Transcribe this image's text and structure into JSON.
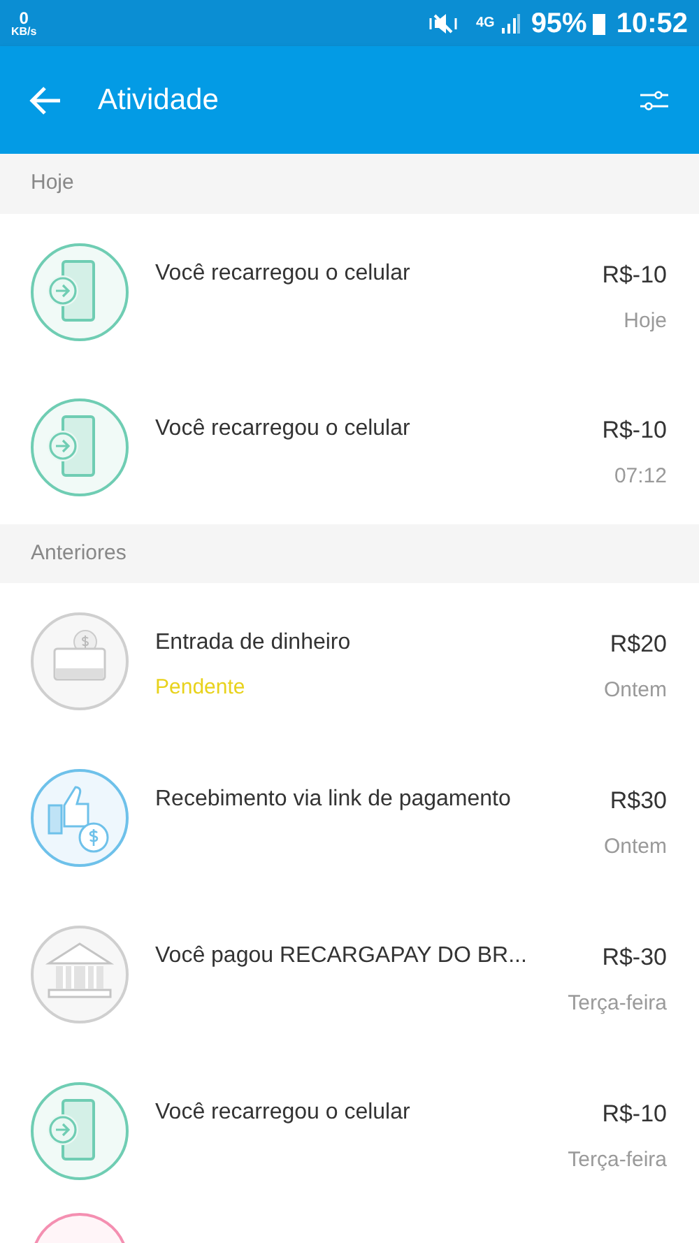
{
  "status_bar": {
    "speed": "0",
    "speed_unit": "KB/s",
    "network": "4G",
    "battery": "95%",
    "time": "10:52"
  },
  "app_bar": {
    "title": "Atividade"
  },
  "sections": [
    {
      "header": "Hoje",
      "items": [
        {
          "kind": "phone",
          "title": "Você recarregou o celular",
          "amount": "R$-10",
          "date": "Hoje"
        },
        {
          "kind": "phone",
          "title": "Você recarregou o celular",
          "amount": "R$-10",
          "date": "07:12"
        }
      ]
    },
    {
      "header": "Anteriores",
      "items": [
        {
          "kind": "cash",
          "title": "Entrada de dinheiro",
          "status": "Pendente",
          "amount": "R$20",
          "date": "Ontem"
        },
        {
          "kind": "thumb",
          "title": "Recebimento via link de pagamento",
          "amount": "R$30",
          "date": "Ontem"
        },
        {
          "kind": "bank",
          "title": "Você pagou RECARGAPAY DO BR...",
          "amount": "R$-30",
          "date": "Terça-feira"
        },
        {
          "kind": "phone",
          "title": "Você recarregou o celular",
          "amount": "R$-10",
          "date": "Terça-feira"
        },
        {
          "kind": "partial"
        }
      ]
    }
  ]
}
